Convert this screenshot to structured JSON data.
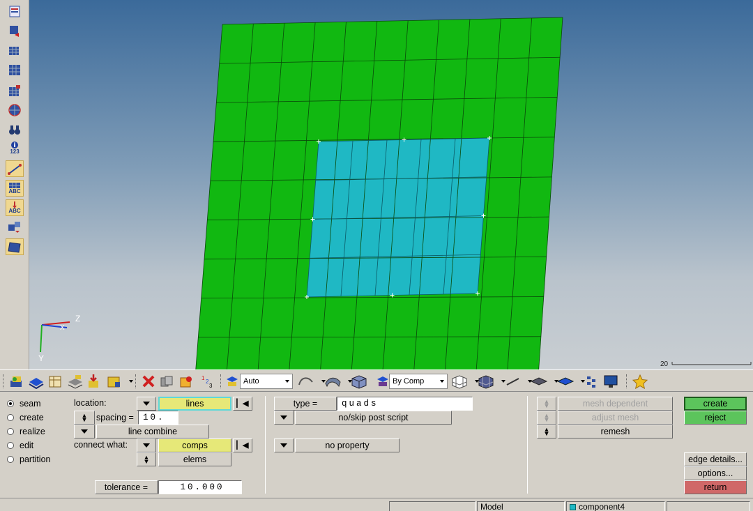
{
  "viewport": {
    "axis_z": "Z",
    "axis_y": "Y",
    "axis_x": "X",
    "scale_label": "20"
  },
  "left_toolbar": {
    "icons": [
      "page-icon",
      "rotate-icon",
      "view-icon",
      "grid-icon",
      "mesh-icon",
      "sphere-icon",
      "binoculars-icon",
      "info-123-icon",
      "measure-icon",
      "abc-label-icon",
      "abc-marker-icon",
      "transform-icon",
      "plane-icon"
    ],
    "info_text": "123",
    "abc_text": "ABC"
  },
  "mid_toolbar": {
    "auto_label": "Auto",
    "bycomp_label": "By Comp"
  },
  "panel": {
    "radios": [
      {
        "label": "seam",
        "selected": true
      },
      {
        "label": "create",
        "selected": false
      },
      {
        "label": "realize",
        "selected": false
      },
      {
        "label": "edit",
        "selected": false
      },
      {
        "label": "partition",
        "selected": false
      }
    ],
    "location_label": "location:",
    "location_value": "lines",
    "spacing_label": "spacing =",
    "spacing_value": "10.",
    "line_combine": "line combine",
    "connect_label": "connect what:",
    "connect_value": "comps",
    "elems": "elems",
    "tolerance_label": "tolerance =",
    "tolerance_value": "10.000",
    "type_label": "type =",
    "type_value": "quads",
    "post_script": "no/skip post script",
    "property": "no property",
    "mesh_dependent": "mesh dependent",
    "adjust_mesh": "adjust mesh",
    "remesh": "remesh",
    "create": "create",
    "reject": "reject",
    "edge_details": "edge details...",
    "options": "options...",
    "return": "return"
  },
  "status": {
    "model": "Model",
    "component": "component4"
  },
  "colors": {
    "outer_mesh": "#11b811",
    "inner_mesh": "#1fb8c4",
    "mesh_lines": "#0a4a0a"
  }
}
